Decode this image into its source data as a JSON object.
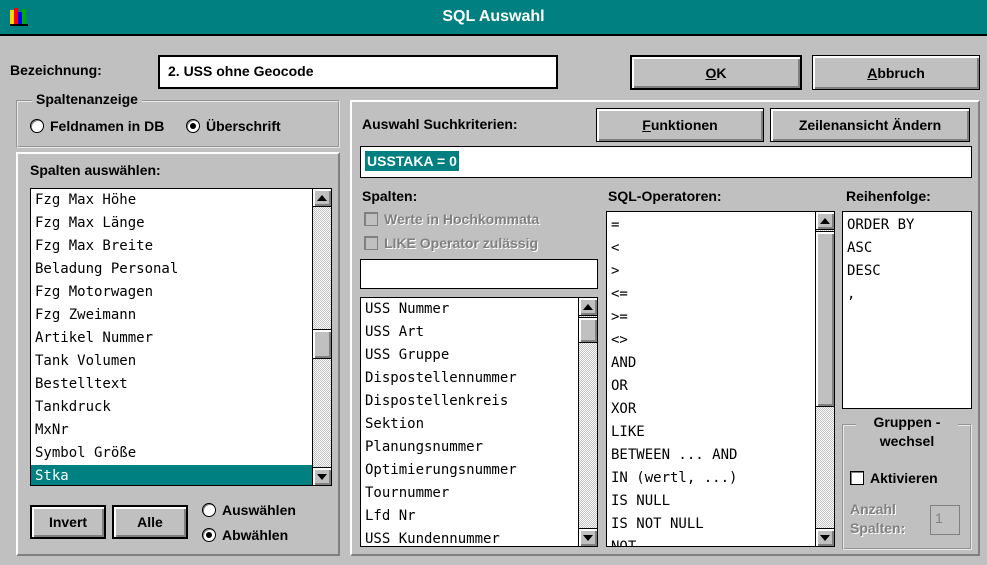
{
  "window": {
    "title": "SQL Auswahl"
  },
  "header": {
    "label": "Bezeichnung:",
    "value": "2. USS ohne Geocode",
    "ok_label_pre": "",
    "ok_label_u": "O",
    "ok_label_post": "K",
    "cancel_label_pre": "",
    "cancel_label_u": "A",
    "cancel_label_post": "bbruch"
  },
  "column_display": {
    "legend": "Spaltenanzeige",
    "options": [
      {
        "label": "Feldnamen in DB",
        "selected": false
      },
      {
        "label": "Überschrift",
        "selected": true
      }
    ]
  },
  "column_select": {
    "title": "Spalten auswählen:",
    "items": [
      "Fzg Max Höhe",
      "Fzg Max Länge",
      "Fzg Max Breite",
      "Beladung Personal",
      "Fzg Motorwagen",
      "Fzg Zweimann",
      "Artikel Nummer",
      "Tank Volumen",
      "Bestelltext",
      "Tankdruck",
      "MxNr",
      "Symbol Größe",
      "Stka"
    ],
    "selected_index": 12,
    "invert_label": "Invert",
    "all_label": "Alle",
    "mode_options": [
      {
        "label": "Auswählen",
        "selected": false
      },
      {
        "label": "Abwählen",
        "selected": true
      }
    ]
  },
  "criteria": {
    "label": "Auswahl Suchkriterien:",
    "functions_label_u": "F",
    "functions_label_post": "unktionen",
    "row_view_label": "Zeilenansicht Ändern",
    "expression": "USSTAKA = 0"
  },
  "columns": {
    "title": "Spalten:",
    "quote_option": "Werte in Hochkommata",
    "like_option": "LIKE Operator zulässig",
    "filter_value": "",
    "items": [
      "USS Nummer",
      "USS Art",
      "USS Gruppe",
      "Dispostellennummer",
      "Dispostellenkreis",
      "Sektion",
      "Planungsnummer",
      "Optimierungsnummer",
      "Tournummer",
      "Lfd Nr",
      "USS Kundennummer"
    ]
  },
  "operators": {
    "title": "SQL-Operatoren:",
    "items": [
      "=",
      "<",
      ">",
      "<=",
      ">=",
      "<>",
      "AND",
      "OR",
      "XOR",
      "LIKE",
      "BETWEEN ... AND",
      "IN (wertl, ...)",
      "IS NULL",
      "IS NOT NULL",
      "NOT"
    ]
  },
  "order": {
    "title": "Reihenfolge:",
    "items": [
      "ORDER BY",
      "ASC",
      "DESC",
      ","
    ]
  },
  "group_change": {
    "legend": "Gruppen - wechsel",
    "activate_label": "Aktivieren",
    "count_label": "Anzahl Spalten:",
    "count_value": "1"
  },
  "colors": {
    "title_bar": "#008080",
    "selection": "#008080",
    "face": "#c0c0c0"
  }
}
